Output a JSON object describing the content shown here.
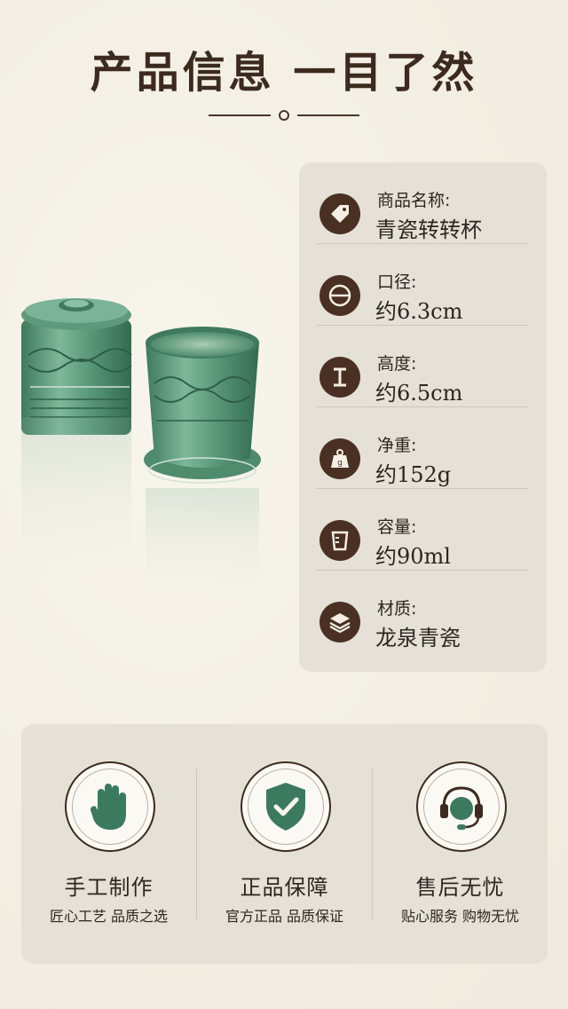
{
  "header": {
    "title": "产品信息 一目了然"
  },
  "specs": [
    {
      "icon": "price-tag-icon",
      "label": "商品名称:",
      "value": "青瓷转转杯"
    },
    {
      "icon": "diameter-icon",
      "label": "口径:",
      "value": "约6.3cm"
    },
    {
      "icon": "height-icon",
      "label": "高度:",
      "value": "约6.5cm"
    },
    {
      "icon": "weight-icon",
      "label": "净重:",
      "value": "约152g"
    },
    {
      "icon": "measuring-cup-icon",
      "label": "容量:",
      "value": "约90ml"
    },
    {
      "icon": "layers-icon",
      "label": "材质:",
      "value": "龙泉青瓷"
    }
  ],
  "features": [
    {
      "icon": "hand-icon",
      "title": "手工制作",
      "subtitle": "匠心工艺  品质之选"
    },
    {
      "icon": "shield-check-icon",
      "title": "正品保障",
      "subtitle": "官方正品  品质保证"
    },
    {
      "icon": "headset-icon",
      "title": "售后无忧",
      "subtitle": "贴心服务  购物无忧"
    }
  ],
  "colors": {
    "background": "#f3efe4",
    "card": "#e5e1d7",
    "icon_dark_brown": "#4a3023",
    "celadon_green": "#4f8c6e",
    "text_dark": "#2e2520"
  }
}
